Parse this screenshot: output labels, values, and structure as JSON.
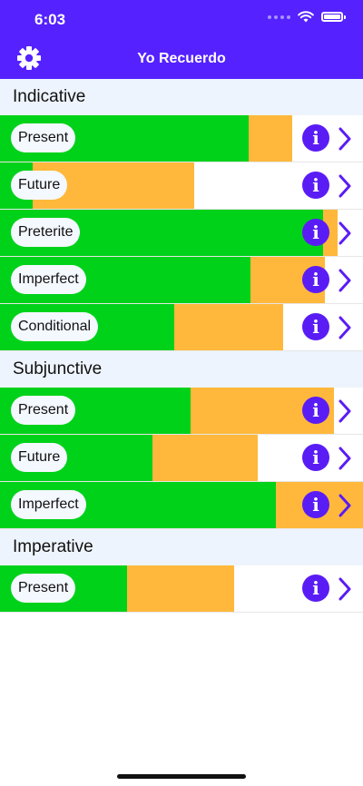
{
  "status_bar": {
    "time": "6:03"
  },
  "header": {
    "title": "Yo Recuerdo",
    "settings_icon": "gear-icon"
  },
  "colors": {
    "accent": "#5522ff",
    "known": "#00d21a",
    "learning": "#ffb83b",
    "section_bg": "#eef4fd"
  },
  "sections": [
    {
      "title": "Indicative",
      "rows": [
        {
          "label": "Present",
          "known": 0.685,
          "learning": 0.12
        },
        {
          "label": "Future",
          "known": 0.09,
          "learning": 0.445
        },
        {
          "label": "Preterite",
          "known": 0.89,
          "learning": 0.04
        },
        {
          "label": "Imperfect",
          "known": 0.69,
          "learning": 0.205
        },
        {
          "label": "Conditional",
          "known": 0.48,
          "learning": 0.3
        }
      ]
    },
    {
      "title": "Subjunctive",
      "rows": [
        {
          "label": "Present",
          "known": 0.525,
          "learning": 0.395
        },
        {
          "label": "Future",
          "known": 0.42,
          "learning": 0.29
        },
        {
          "label": "Imperfect",
          "known": 0.76,
          "learning": 0.24
        }
      ]
    },
    {
      "title": "Imperative",
      "rows": [
        {
          "label": "Present",
          "known": 0.35,
          "learning": 0.295
        }
      ]
    }
  ]
}
